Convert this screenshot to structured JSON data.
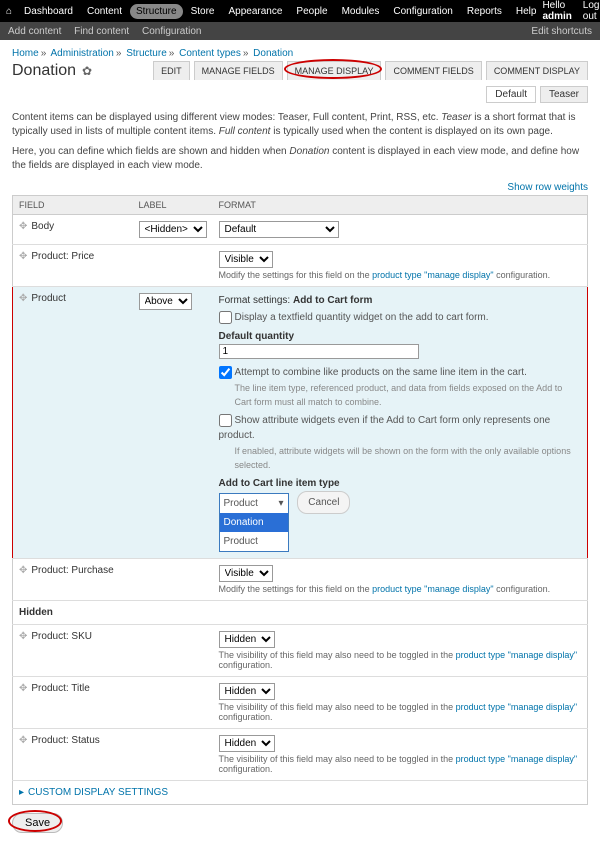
{
  "topbar": {
    "menu": [
      "Dashboard",
      "Content",
      "Structure",
      "Store",
      "Appearance",
      "People",
      "Modules",
      "Configuration",
      "Reports",
      "Help"
    ],
    "active_index": 2,
    "hello": "Hello",
    "user": "admin",
    "logout": "Log out"
  },
  "subbar": {
    "left": [
      "Add content",
      "Find content",
      "Configuration"
    ],
    "right": "Edit shortcuts"
  },
  "breadcrumb": [
    "Home",
    "Administration",
    "Structure",
    "Content types",
    "Donation"
  ],
  "page_title": "Donation",
  "tabs": [
    "EDIT",
    "MANAGE FIELDS",
    "MANAGE DISPLAY",
    "COMMENT FIELDS",
    "COMMENT DISPLAY"
  ],
  "active_tab": 2,
  "subtabs": {
    "default": "Default",
    "teaser": "Teaser"
  },
  "intro": {
    "p1a": "Content items can be displayed using different view modes: Teaser, Full content, Print, RSS, etc. ",
    "p1b": "Teaser",
    "p1c": " is a short format that is typically used in lists of multiple content items. ",
    "p1d": "Full content",
    "p1e": " is typically used when the content is displayed on its own page.",
    "p2a": "Here, you can define which fields are shown and hidden when ",
    "p2b": "Donation",
    "p2c": " content is displayed in each view mode, and define how the fields are displayed in each view mode."
  },
  "show_row_weights": "Show row weights",
  "headers": {
    "field": "FIELD",
    "label": "LABEL",
    "format": "FORMAT"
  },
  "rows": {
    "body": {
      "name": "Body",
      "label": "<Hidden>",
      "format": "Default"
    },
    "price": {
      "name": "Product: Price",
      "format": "Visible",
      "hint_pre": "Modify the settings for this field on the ",
      "hint_link": "product type \"manage display\"",
      "hint_post": " configuration."
    },
    "product": {
      "name": "Product",
      "label": "Above",
      "fs_title": "Format settings: ",
      "fs_title_b": "Add to Cart form",
      "cb1": "Display a textfield quantity widget on the add to cart form.",
      "dq_label": "Default quantity",
      "dq_value": "1",
      "cb2": "Attempt to combine like products on the same line item in the cart.",
      "cb2_sub": "The line item type, referenced product, and data from fields exposed on the Add to Cart form must all match to combine.",
      "cb3": "Show attribute widgets even if the Add to Cart form only represents one product.",
      "cb3_sub": "If enabled, attribute widgets will be shown on the form with the only available options selected.",
      "litype_label": "Add to Cart line item type",
      "litype_selected": "Product",
      "litype_options": [
        "Donation",
        "Product"
      ],
      "cancel": "Cancel"
    },
    "purchase": {
      "name": "Product: Purchase",
      "format": "Visible",
      "hint_pre": "Modify the settings for this field on the ",
      "hint_link": "product type \"manage display\"",
      "hint_post": " configuration."
    },
    "hidden_hdr": "Hidden",
    "sku": {
      "name": "Product: SKU",
      "format": "Hidden",
      "hint_pre": "The visibility of this field may also need to be toggled in the ",
      "hint_link": "product type \"manage display\"",
      "hint_post": " configuration."
    },
    "title": {
      "name": "Product: Title",
      "format": "Hidden",
      "hint_pre": "The visibility of this field may also need to be toggled in the ",
      "hint_link": "product type \"manage display\"",
      "hint_post": " configuration."
    },
    "status": {
      "name": "Product: Status",
      "format": "Hidden",
      "hint_pre": "The visibility of this field may also need to be toggled in the ",
      "hint_link": "product type \"manage display\"",
      "hint_post": " configuration."
    }
  },
  "custom_display": "CUSTOM DISPLAY SETTINGS",
  "save": "Save"
}
